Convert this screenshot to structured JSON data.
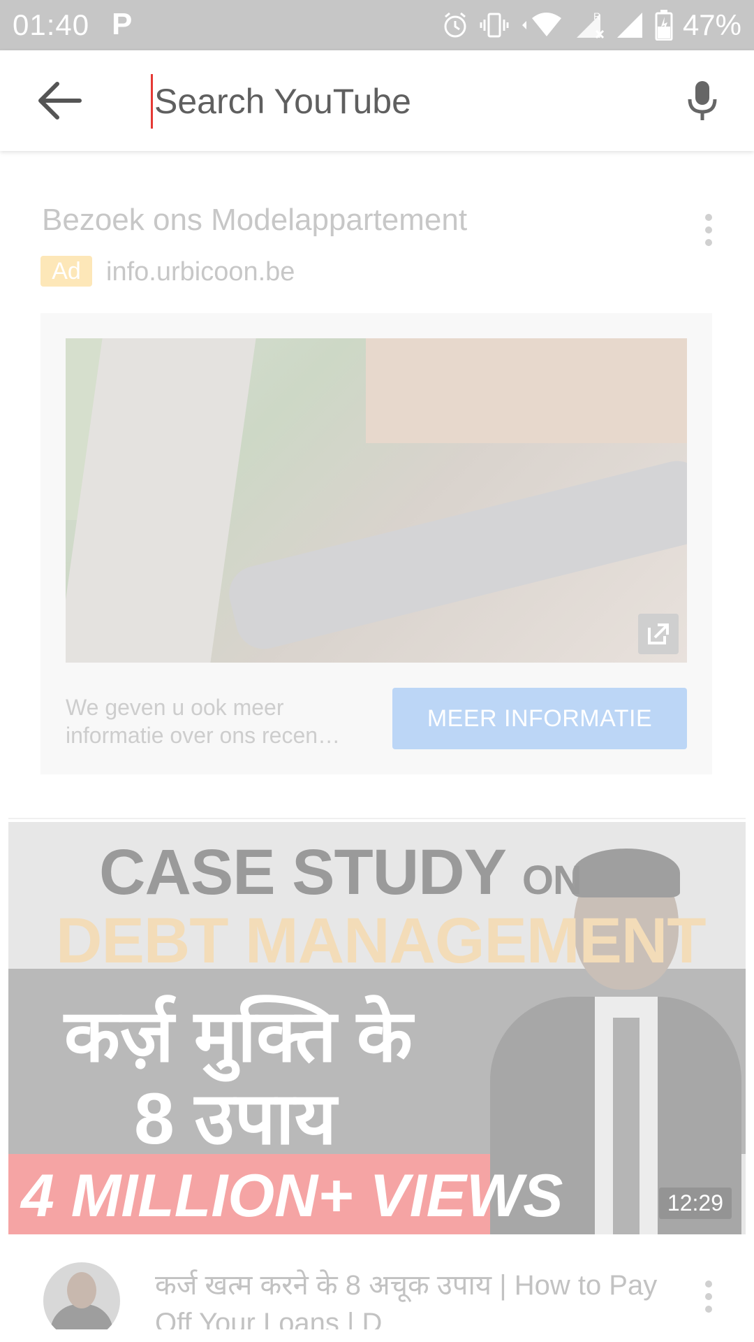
{
  "status_bar": {
    "time": "01:40",
    "app_indicator": "P",
    "battery_percent": "47%",
    "icons": [
      "alarm-icon",
      "vibrate-icon",
      "wifi-icon",
      "signal-roaming-icon",
      "signal-icon",
      "battery-icon"
    ]
  },
  "search": {
    "placeholder": "Search YouTube",
    "back_icon": "arrow-back-icon",
    "mic_icon": "mic-icon"
  },
  "ad": {
    "title": "Bezoek ons Modelappartement",
    "badge": "Ad",
    "domain": "info.urbicoon.be",
    "description": "We geven u ook meer informatie over ons recen…",
    "cta": "MEER INFORMATIE",
    "colors": {
      "badge": "#fde7b8",
      "cta": "#bcd6f6"
    }
  },
  "video": {
    "thumbnail_text": {
      "line1": "CASE  STUDY",
      "line1_small": "ON",
      "line2": "DEBT MANAGEMENT",
      "line3": "कर्ज़ मुक्ति के",
      "line4": "8 उपाय",
      "line5": "4 MILLION+ VIEWS"
    },
    "duration": "12:29",
    "title": "कर्ज खत्म करने के 8 अचूक उपाय | How to Pay Off Your Loans | D"
  }
}
